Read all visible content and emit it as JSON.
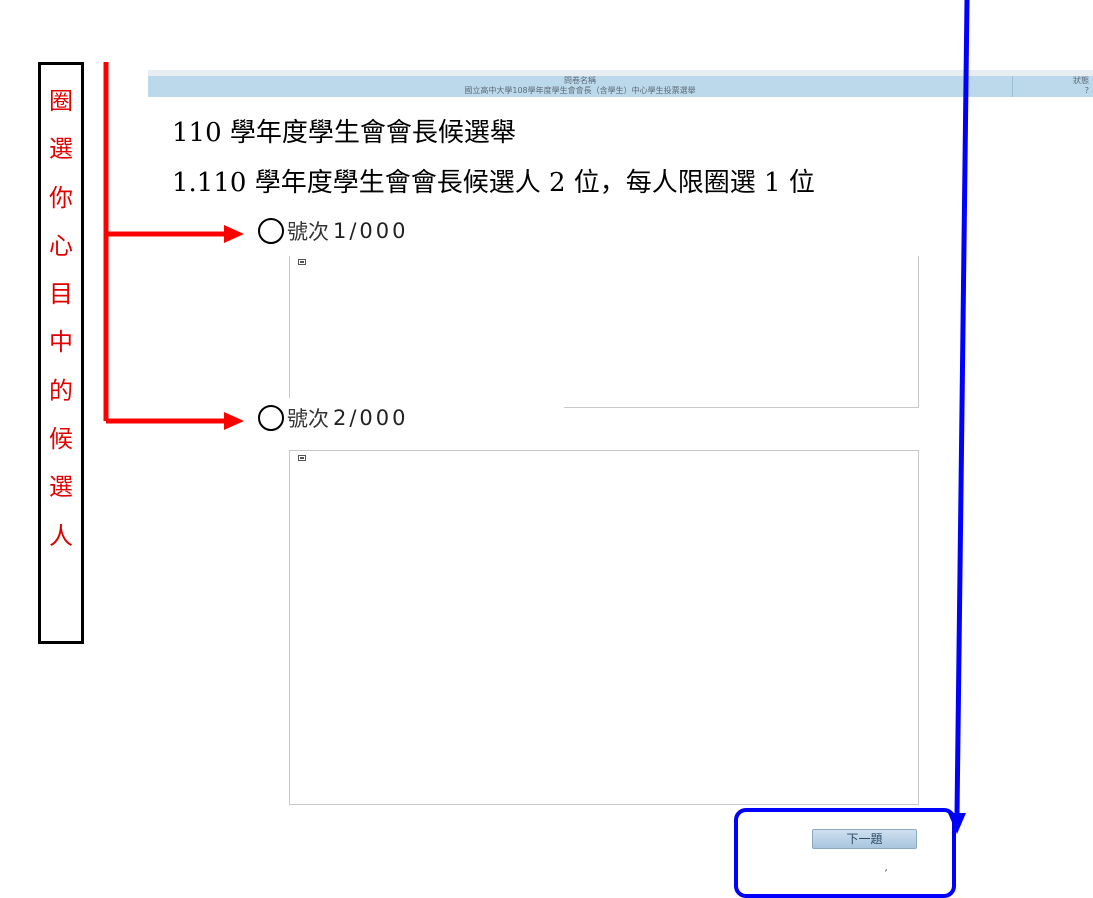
{
  "annotation": {
    "characters": [
      "圈",
      "選",
      "你",
      "心",
      "目",
      "中",
      "的",
      "候",
      "選",
      "人"
    ],
    "text_color": "#e00000"
  },
  "header": {
    "column1_label": "問卷名稱",
    "column1_value": "國立高中大學108學年度學生會會長（含學生）中心學生投票選舉",
    "column2_label": "狀態",
    "column2_value": "?"
  },
  "survey": {
    "title": "110 學年度學生會會長候選舉",
    "question": "1.110 學年度學生會會長候選人 2 位，每人限圈選 1 位"
  },
  "options": [
    {
      "prefix": "號次",
      "number": "1/000"
    },
    {
      "prefix": "號次",
      "number": "2/000"
    }
  ],
  "next_button": {
    "label": "下一題"
  },
  "arrow_colors": {
    "red": "#ff0000",
    "blue": "#0000ff"
  }
}
